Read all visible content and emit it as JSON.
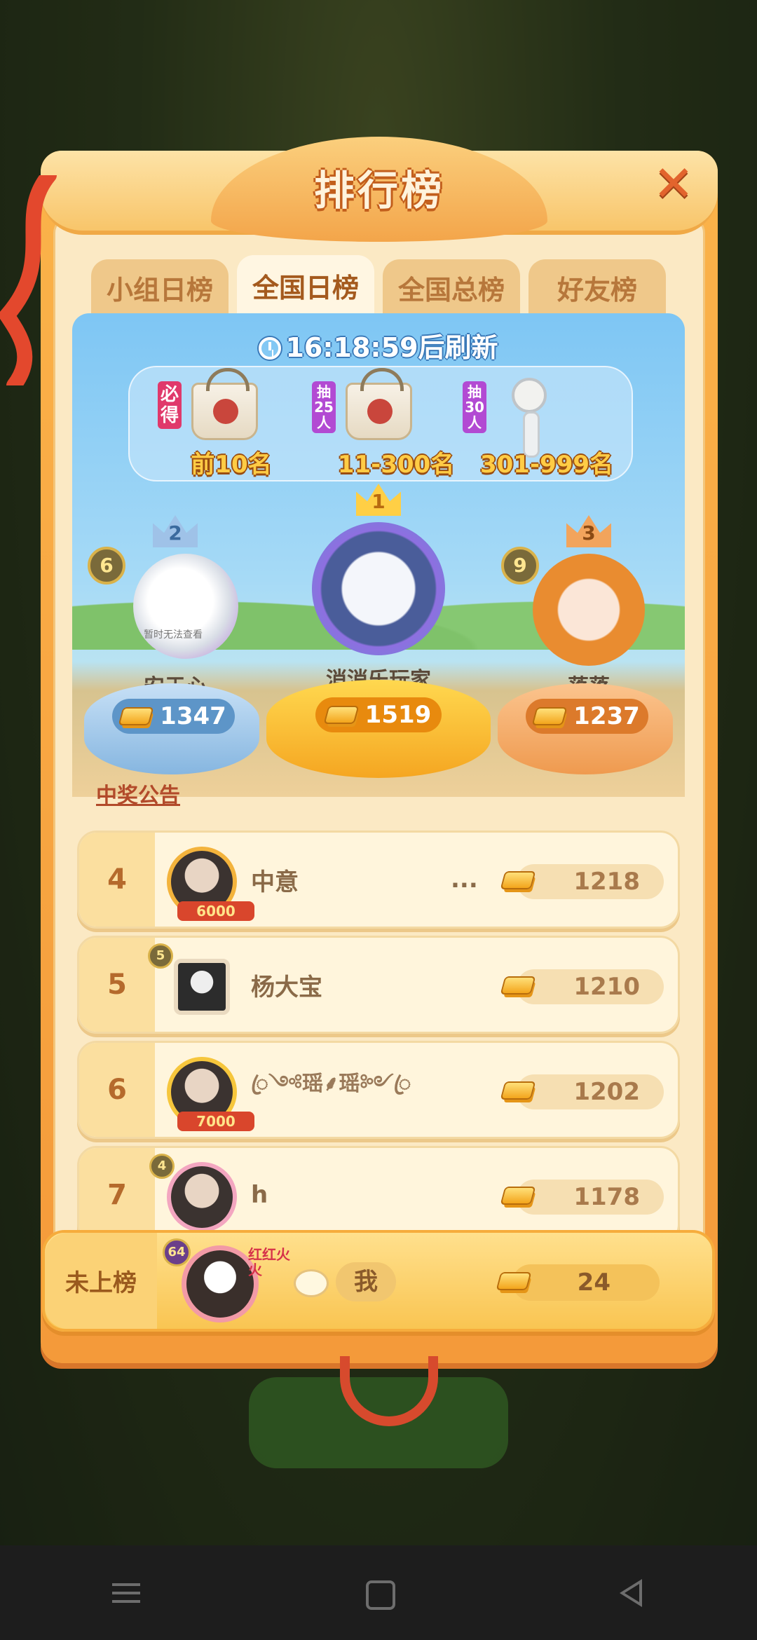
{
  "title": "排行榜",
  "tabs": [
    {
      "label": "小组日榜",
      "active": false
    },
    {
      "label": "全国日榜",
      "active": true
    },
    {
      "label": "全国总榜",
      "active": false
    },
    {
      "label": "好友榜",
      "active": false
    }
  ],
  "countdown": "16:18:59后刷新",
  "rewards": [
    {
      "tag": "必得",
      "label": "前10名",
      "item": "bag-icon"
    },
    {
      "tag": "抽25人",
      "label": "11-300名",
      "item": "bag-icon"
    },
    {
      "tag": "抽30人",
      "label": "301-999名",
      "item": "fan-icon"
    }
  ],
  "podium": {
    "first": {
      "rank": "1",
      "name": "消消乐玩家",
      "score": "1519"
    },
    "second": {
      "rank": "2",
      "name": "安于心",
      "score": "1347",
      "level": "6",
      "avatar_note": "暂时无法查看"
    },
    "third": {
      "rank": "3",
      "name": "落落",
      "score": "1237",
      "level": "9"
    }
  },
  "announcement": "中奖公告",
  "list": [
    {
      "rank": "4",
      "name": "中意",
      "more": "...",
      "score": "1218",
      "frame_score": "6000"
    },
    {
      "rank": "5",
      "name": "杨大宝",
      "score": "1210",
      "level": "5"
    },
    {
      "rank": "6",
      "name": "ꦿ༺瑶⸙瑶༻ꦿ",
      "score": "1202",
      "frame_score": "7000"
    },
    {
      "rank": "7",
      "name": "h",
      "score": "1178",
      "level": "4"
    }
  ],
  "me": {
    "rank_label": "未上榜",
    "name": "我",
    "score": "24",
    "level": "64",
    "frame_text": "红红火火"
  },
  "colors": {
    "panel": "#f49a3a",
    "accent": "#fbdf9f",
    "sky": "#7ec6f4"
  }
}
